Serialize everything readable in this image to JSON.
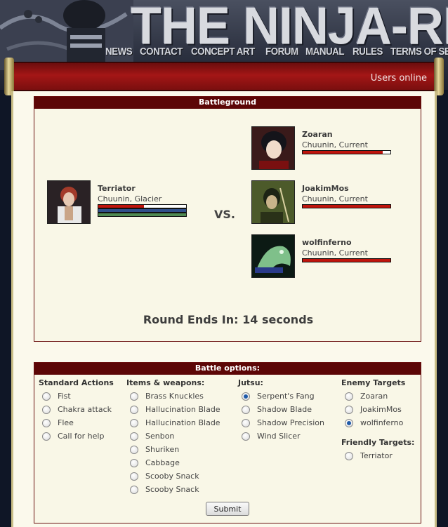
{
  "site": {
    "logo": "THE NINJA-RPG",
    "nav": [
      "NEWS",
      "CONTACT",
      "CONCEPT ART",
      "FORUM",
      "MANUAL",
      "RULES",
      "TERMS OF SERVICE"
    ],
    "users_online": "Users online"
  },
  "battleground": {
    "title": "Battleground",
    "vs": "VS.",
    "player": {
      "name": "Terriator",
      "rank": "Chuunin, Glacier",
      "health": 0.52,
      "chakra": 1.0,
      "stamina": 1.0
    },
    "opponents": [
      {
        "name": "Zoaran",
        "rank": "Chuunin, Current",
        "health": 0.91
      },
      {
        "name": "JoakimMos",
        "rank": "Chuunin, Current",
        "health": 1.0
      },
      {
        "name": "wolfinferno",
        "rank": "Chuunin, Current",
        "health": 1.0
      }
    ],
    "round_text": "Round Ends In: 14 seconds"
  },
  "options": {
    "title": "Battle options:",
    "standard": {
      "header": "Standard Actions",
      "items": [
        "Fist",
        "Chakra attack",
        "Flee",
        "Call for help"
      ]
    },
    "items": {
      "header": "Items & weapons:",
      "items": [
        "Brass Knuckles",
        "Hallucination Blade",
        "Hallucination Blade",
        "Senbon",
        "Shuriken",
        "Cabbage",
        "Scooby Snack",
        "Scooby Snack"
      ]
    },
    "jutsu": {
      "header": "Jutsu:",
      "items": [
        "Serpent's Fang",
        "Shadow Blade",
        "Shadow Precision",
        "Wind Slicer"
      ],
      "selected": "Serpent's Fang"
    },
    "enemy": {
      "header": "Enemy Targets",
      "items": [
        "Zoaran",
        "JoakimMos",
        "wolfinferno"
      ],
      "selected": "wolfinferno"
    },
    "friendly": {
      "header": "Friendly Targets:",
      "items": [
        "Terriator"
      ]
    },
    "submit_label": "Submit"
  },
  "colors": {
    "health": "#c0140c",
    "chakra": "#2f4f8a",
    "stamina": "#4f8a52",
    "title_bar": "#5c0606"
  }
}
